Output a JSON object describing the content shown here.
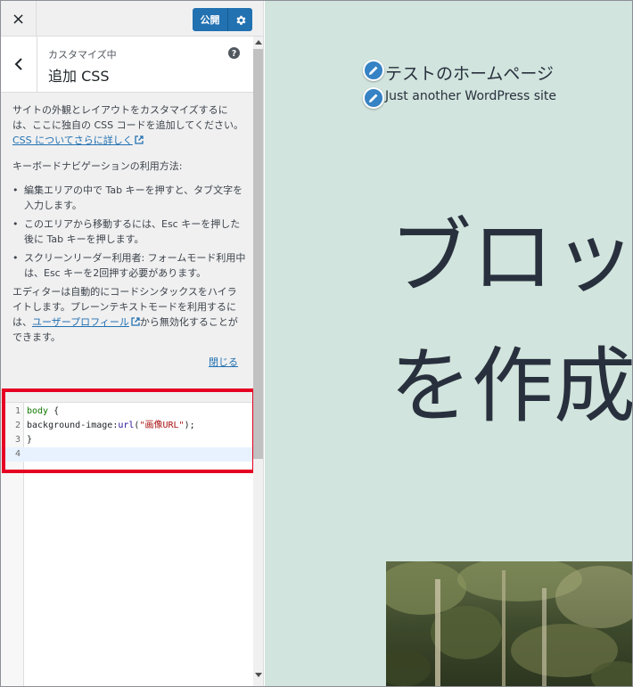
{
  "topbar": {
    "close_label": "×",
    "publish_label": "公開"
  },
  "section": {
    "subtitle": "カスタマイズ中",
    "title": "追加 CSS"
  },
  "description": {
    "para1": "サイトの外観とレイアウトをカスタマイズするには、ここに独自の CSS コードを追加してください。",
    "link1": "CSS についてさらに詳しく",
    "para2": "キーボードナビゲーションの利用方法:",
    "bullets": [
      "編集エリアの中で Tab キーを押すと、タブ文字を入力します。",
      "このエリアから移動するには、Esc キーを押した後に Tab キーを押します。",
      "スクリーンリーダー利用者: フォームモード利用中は、Esc キーを2回押す必要があります。"
    ],
    "para3_pre": "エディターは自動的にコードシンタックスをハイライトします。プレーンテキストモードを利用するには、",
    "link2": "ユーザープロフィール",
    "para3_post": "から無効化することができます。",
    "close_link": "閉じる"
  },
  "editor": {
    "line_numbers": [
      "1",
      "2",
      "3",
      "4"
    ],
    "line1_selector": "body",
    "line1_brace": " {",
    "line2_prop": "background-image",
    "line2_colon": ":",
    "line2_func": "url",
    "line2_open": "(",
    "line2_str": "\"画像URL\"",
    "line2_close": ");",
    "line3": "}",
    "active_line": 4
  },
  "preview": {
    "site_title": "テストのホームページ",
    "site_description": "Just another WordPress site",
    "hero_line1": "ブロッ",
    "hero_line2": "を作成"
  },
  "colors": {
    "accent": "#2271b1",
    "preview_bg": "#d1e4dd",
    "highlight": "#e60023"
  }
}
